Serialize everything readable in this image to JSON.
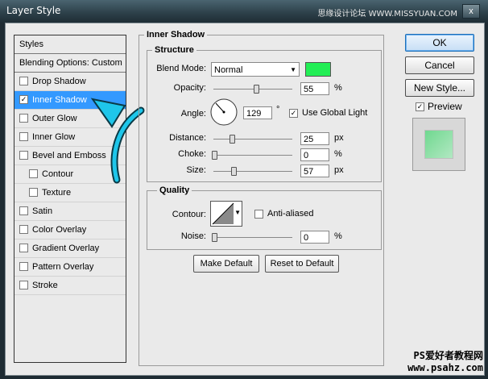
{
  "window": {
    "title": "Layer Style",
    "close_label": "x",
    "watermark_top": "思缘设计论坛 WWW.MISSYUAN.COM"
  },
  "styles_panel": {
    "header": "Styles",
    "blending": "Blending Options: Custom",
    "items": [
      {
        "label": "Drop Shadow",
        "checked": false,
        "indent": false
      },
      {
        "label": "Inner Shadow",
        "checked": true,
        "indent": false,
        "selected": true
      },
      {
        "label": "Outer Glow",
        "checked": false,
        "indent": false
      },
      {
        "label": "Inner Glow",
        "checked": false,
        "indent": false
      },
      {
        "label": "Bevel and Emboss",
        "checked": false,
        "indent": false
      },
      {
        "label": "Contour",
        "checked": false,
        "indent": true
      },
      {
        "label": "Texture",
        "checked": false,
        "indent": true
      },
      {
        "label": "Satin",
        "checked": false,
        "indent": false
      },
      {
        "label": "Color Overlay",
        "checked": false,
        "indent": false
      },
      {
        "label": "Gradient Overlay",
        "checked": false,
        "indent": false
      },
      {
        "label": "Pattern Overlay",
        "checked": false,
        "indent": false
      },
      {
        "label": "Stroke",
        "checked": false,
        "indent": false
      }
    ]
  },
  "inner_shadow": {
    "title": "Inner Shadow",
    "structure": {
      "title": "Structure",
      "blend_mode_label": "Blend Mode:",
      "blend_mode_value": "Normal",
      "color": "#22ee55",
      "opacity_label": "Opacity:",
      "opacity_value": "55",
      "opacity_unit": "%",
      "angle_label": "Angle:",
      "angle_value": "129",
      "angle_unit": "°",
      "use_global_light": "Use Global Light",
      "global_light_checked": true,
      "distance_label": "Distance:",
      "distance_value": "25",
      "distance_unit": "px",
      "choke_label": "Choke:",
      "choke_value": "0",
      "choke_unit": "%",
      "size_label": "Size:",
      "size_value": "57",
      "size_unit": "px"
    },
    "quality": {
      "title": "Quality",
      "contour_label": "Contour:",
      "anti_aliased": "Anti-aliased",
      "noise_label": "Noise:",
      "noise_value": "0",
      "noise_unit": "%"
    },
    "make_default": "Make Default",
    "reset_default": "Reset to Default"
  },
  "right": {
    "ok": "OK",
    "cancel": "Cancel",
    "new_style": "New Style...",
    "preview": "Preview",
    "preview_checked": true
  },
  "watermark_bottom": {
    "line1": "PS爱好者教程网",
    "line2": "www.psahz.com"
  },
  "colors": {
    "selection": "#3399ff",
    "arrow": "#1ec6ea",
    "shadow_color": "#22ee55"
  }
}
